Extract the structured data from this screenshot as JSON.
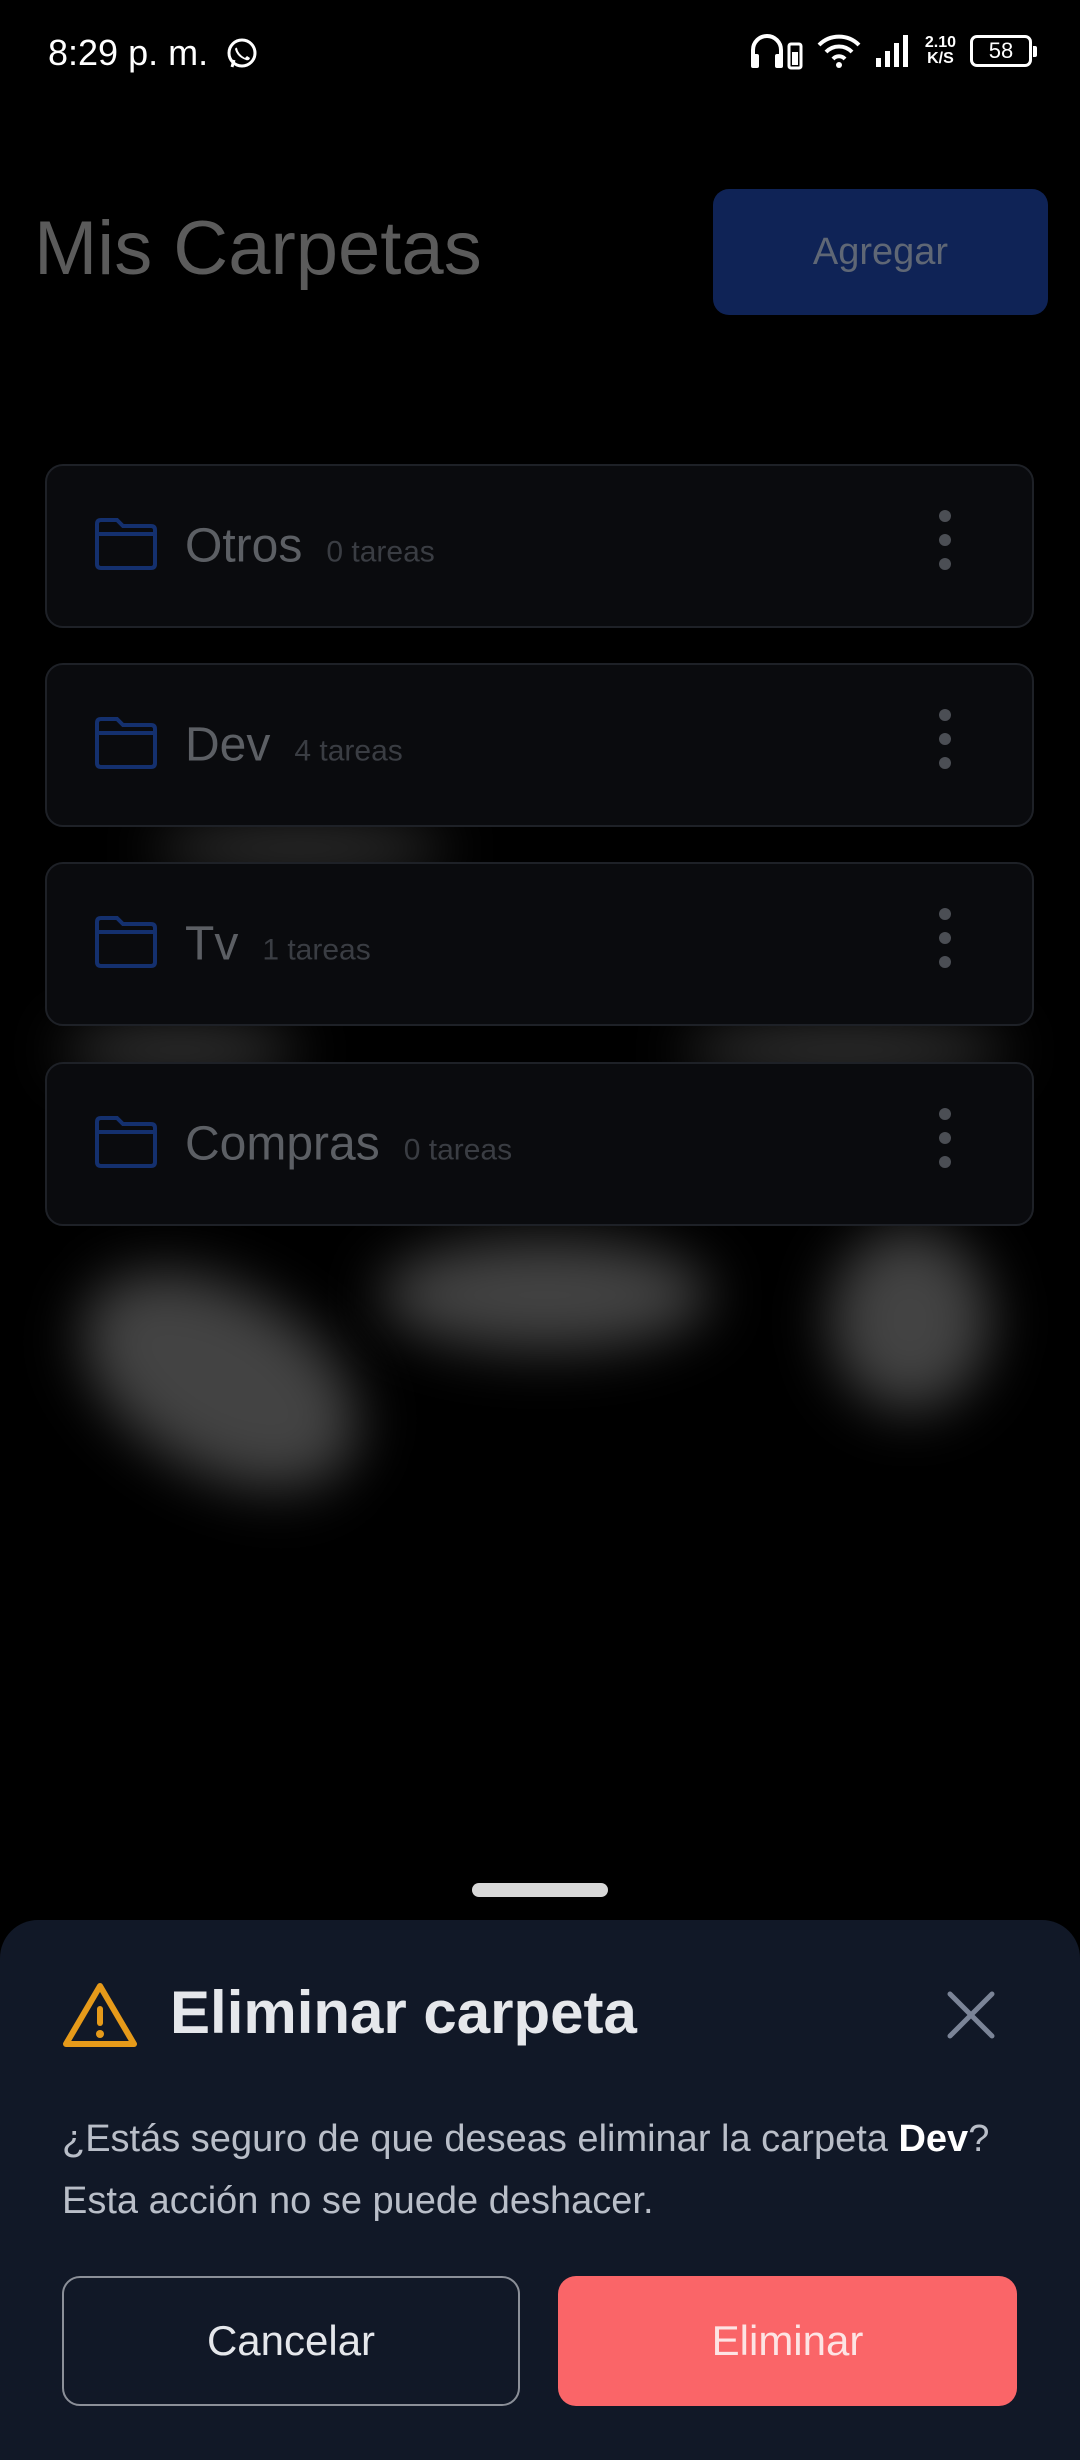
{
  "status_bar": {
    "time": "8:29 p. m.",
    "net_speed_value": "2.10",
    "net_speed_unit": "K/S",
    "battery": "58",
    "icons": [
      "whatsapp-icon",
      "headphones-battery-icon",
      "wifi-icon",
      "signal-icon",
      "battery-icon"
    ]
  },
  "header": {
    "title": "Mis Carpetas",
    "add_label": "Agregar"
  },
  "folders": [
    {
      "name": "Otros",
      "count": "0 tareas"
    },
    {
      "name": "Dev",
      "count": "4 tareas"
    },
    {
      "name": "Tv",
      "count": "1 tareas"
    },
    {
      "name": "Compras",
      "count": "0 tareas"
    }
  ],
  "dialog": {
    "title": "Eliminar carpeta",
    "message_before": "¿Estás seguro de que deseas eliminar la carpeta ",
    "folder_name": "Dev",
    "message_after": "? Esta acción no se puede deshacer.",
    "cancel_label": "Cancelar",
    "delete_label": "Eliminar"
  },
  "colors": {
    "accent_blue": "#0f2356",
    "danger": "#fa6568",
    "warning": "#e69a1a",
    "sheet_bg": "#111827"
  }
}
